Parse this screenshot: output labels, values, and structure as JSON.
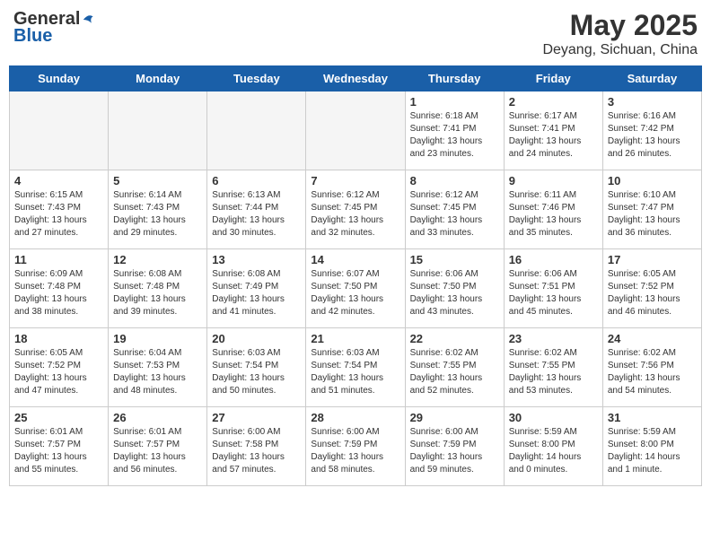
{
  "header": {
    "logo_general": "General",
    "logo_blue": "Blue",
    "title": "May 2025",
    "subtitle": "Deyang, Sichuan, China"
  },
  "days_of_week": [
    "Sunday",
    "Monday",
    "Tuesday",
    "Wednesday",
    "Thursday",
    "Friday",
    "Saturday"
  ],
  "weeks": [
    [
      {
        "day": "",
        "info": ""
      },
      {
        "day": "",
        "info": ""
      },
      {
        "day": "",
        "info": ""
      },
      {
        "day": "",
        "info": ""
      },
      {
        "day": "1",
        "info": "Sunrise: 6:18 AM\nSunset: 7:41 PM\nDaylight: 13 hours\nand 23 minutes."
      },
      {
        "day": "2",
        "info": "Sunrise: 6:17 AM\nSunset: 7:41 PM\nDaylight: 13 hours\nand 24 minutes."
      },
      {
        "day": "3",
        "info": "Sunrise: 6:16 AM\nSunset: 7:42 PM\nDaylight: 13 hours\nand 26 minutes."
      }
    ],
    [
      {
        "day": "4",
        "info": "Sunrise: 6:15 AM\nSunset: 7:43 PM\nDaylight: 13 hours\nand 27 minutes."
      },
      {
        "day": "5",
        "info": "Sunrise: 6:14 AM\nSunset: 7:43 PM\nDaylight: 13 hours\nand 29 minutes."
      },
      {
        "day": "6",
        "info": "Sunrise: 6:13 AM\nSunset: 7:44 PM\nDaylight: 13 hours\nand 30 minutes."
      },
      {
        "day": "7",
        "info": "Sunrise: 6:12 AM\nSunset: 7:45 PM\nDaylight: 13 hours\nand 32 minutes."
      },
      {
        "day": "8",
        "info": "Sunrise: 6:12 AM\nSunset: 7:45 PM\nDaylight: 13 hours\nand 33 minutes."
      },
      {
        "day": "9",
        "info": "Sunrise: 6:11 AM\nSunset: 7:46 PM\nDaylight: 13 hours\nand 35 minutes."
      },
      {
        "day": "10",
        "info": "Sunrise: 6:10 AM\nSunset: 7:47 PM\nDaylight: 13 hours\nand 36 minutes."
      }
    ],
    [
      {
        "day": "11",
        "info": "Sunrise: 6:09 AM\nSunset: 7:48 PM\nDaylight: 13 hours\nand 38 minutes."
      },
      {
        "day": "12",
        "info": "Sunrise: 6:08 AM\nSunset: 7:48 PM\nDaylight: 13 hours\nand 39 minutes."
      },
      {
        "day": "13",
        "info": "Sunrise: 6:08 AM\nSunset: 7:49 PM\nDaylight: 13 hours\nand 41 minutes."
      },
      {
        "day": "14",
        "info": "Sunrise: 6:07 AM\nSunset: 7:50 PM\nDaylight: 13 hours\nand 42 minutes."
      },
      {
        "day": "15",
        "info": "Sunrise: 6:06 AM\nSunset: 7:50 PM\nDaylight: 13 hours\nand 43 minutes."
      },
      {
        "day": "16",
        "info": "Sunrise: 6:06 AM\nSunset: 7:51 PM\nDaylight: 13 hours\nand 45 minutes."
      },
      {
        "day": "17",
        "info": "Sunrise: 6:05 AM\nSunset: 7:52 PM\nDaylight: 13 hours\nand 46 minutes."
      }
    ],
    [
      {
        "day": "18",
        "info": "Sunrise: 6:05 AM\nSunset: 7:52 PM\nDaylight: 13 hours\nand 47 minutes."
      },
      {
        "day": "19",
        "info": "Sunrise: 6:04 AM\nSunset: 7:53 PM\nDaylight: 13 hours\nand 48 minutes."
      },
      {
        "day": "20",
        "info": "Sunrise: 6:03 AM\nSunset: 7:54 PM\nDaylight: 13 hours\nand 50 minutes."
      },
      {
        "day": "21",
        "info": "Sunrise: 6:03 AM\nSunset: 7:54 PM\nDaylight: 13 hours\nand 51 minutes."
      },
      {
        "day": "22",
        "info": "Sunrise: 6:02 AM\nSunset: 7:55 PM\nDaylight: 13 hours\nand 52 minutes."
      },
      {
        "day": "23",
        "info": "Sunrise: 6:02 AM\nSunset: 7:55 PM\nDaylight: 13 hours\nand 53 minutes."
      },
      {
        "day": "24",
        "info": "Sunrise: 6:02 AM\nSunset: 7:56 PM\nDaylight: 13 hours\nand 54 minutes."
      }
    ],
    [
      {
        "day": "25",
        "info": "Sunrise: 6:01 AM\nSunset: 7:57 PM\nDaylight: 13 hours\nand 55 minutes."
      },
      {
        "day": "26",
        "info": "Sunrise: 6:01 AM\nSunset: 7:57 PM\nDaylight: 13 hours\nand 56 minutes."
      },
      {
        "day": "27",
        "info": "Sunrise: 6:00 AM\nSunset: 7:58 PM\nDaylight: 13 hours\nand 57 minutes."
      },
      {
        "day": "28",
        "info": "Sunrise: 6:00 AM\nSunset: 7:59 PM\nDaylight: 13 hours\nand 58 minutes."
      },
      {
        "day": "29",
        "info": "Sunrise: 6:00 AM\nSunset: 7:59 PM\nDaylight: 13 hours\nand 59 minutes."
      },
      {
        "day": "30",
        "info": "Sunrise: 5:59 AM\nSunset: 8:00 PM\nDaylight: 14 hours\nand 0 minutes."
      },
      {
        "day": "31",
        "info": "Sunrise: 5:59 AM\nSunset: 8:00 PM\nDaylight: 14 hours\nand 1 minute."
      }
    ]
  ]
}
